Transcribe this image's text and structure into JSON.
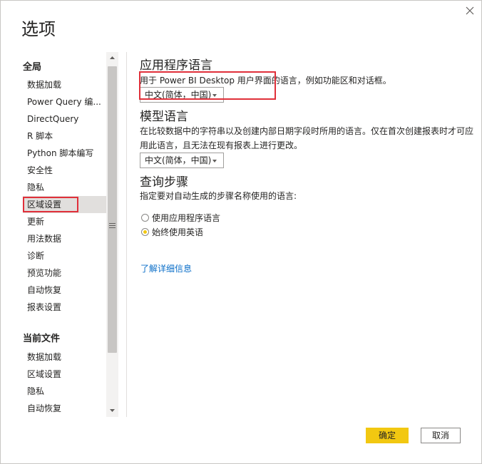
{
  "dialog": {
    "title": "选项",
    "close_icon": "close-icon"
  },
  "sidebar": {
    "global_title": "全局",
    "global_items": [
      {
        "label": "数据加载"
      },
      {
        "label": "Power Query 编..."
      },
      {
        "label": "DirectQuery"
      },
      {
        "label": "R 脚本"
      },
      {
        "label": "Python 脚本编写"
      },
      {
        "label": "安全性"
      },
      {
        "label": "隐私"
      },
      {
        "label": "区域设置",
        "selected": true
      },
      {
        "label": "更新"
      },
      {
        "label": "用法数据"
      },
      {
        "label": "诊断"
      },
      {
        "label": "预览功能"
      },
      {
        "label": "自动恢复"
      },
      {
        "label": "报表设置"
      }
    ],
    "file_title": "当前文件",
    "file_items": [
      {
        "label": "数据加载"
      },
      {
        "label": "区域设置"
      },
      {
        "label": "隐私"
      },
      {
        "label": "自动恢复"
      }
    ]
  },
  "main": {
    "app_language": {
      "heading": "应用程序语言",
      "description": "用于 Power BI Desktop 用户界面的语言，例如功能区和对话框。",
      "selected": "中文(简体，中国)"
    },
    "model_language": {
      "heading": "模型语言",
      "description": "在比较数据中的字符串以及创建内部日期字段时所用的语言。仅在首次创建报表时才可应用此语言，且无法在现有报表上进行更改。",
      "selected": "中文(简体，中国)"
    },
    "query_steps": {
      "heading": "查询步骤",
      "description": "指定要对自动生成的步骤名称使用的语言:",
      "options": [
        {
          "label": "使用应用程序语言",
          "checked": false
        },
        {
          "label": "始终使用英语",
          "checked": true
        }
      ]
    },
    "learn_more": "了解详细信息"
  },
  "footer": {
    "ok_label": "确定",
    "cancel_label": "取消"
  },
  "colors": {
    "accent": "#f2c811",
    "highlight": "#e0303a",
    "link": "#0a6ec8",
    "selected_bg": "#e1dfdd"
  }
}
